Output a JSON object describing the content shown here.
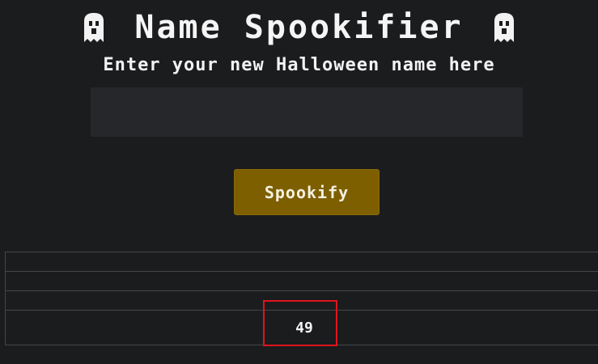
{
  "header": {
    "title": "Name Spookifier",
    "left_icon": "ghost-icon",
    "right_icon": "ghost-icon"
  },
  "form": {
    "prompt": "Enter your new Halloween name here",
    "name_input_value": "",
    "submit_label": "Spookify"
  },
  "results": {
    "rows": [
      "",
      "",
      "",
      "49"
    ]
  },
  "highlight": {
    "color": "#e0141b"
  },
  "colors": {
    "background": "#1b1c1e",
    "input_background": "#25272a",
    "button_background": "#7d5f00",
    "text": "#f2f2f2"
  }
}
